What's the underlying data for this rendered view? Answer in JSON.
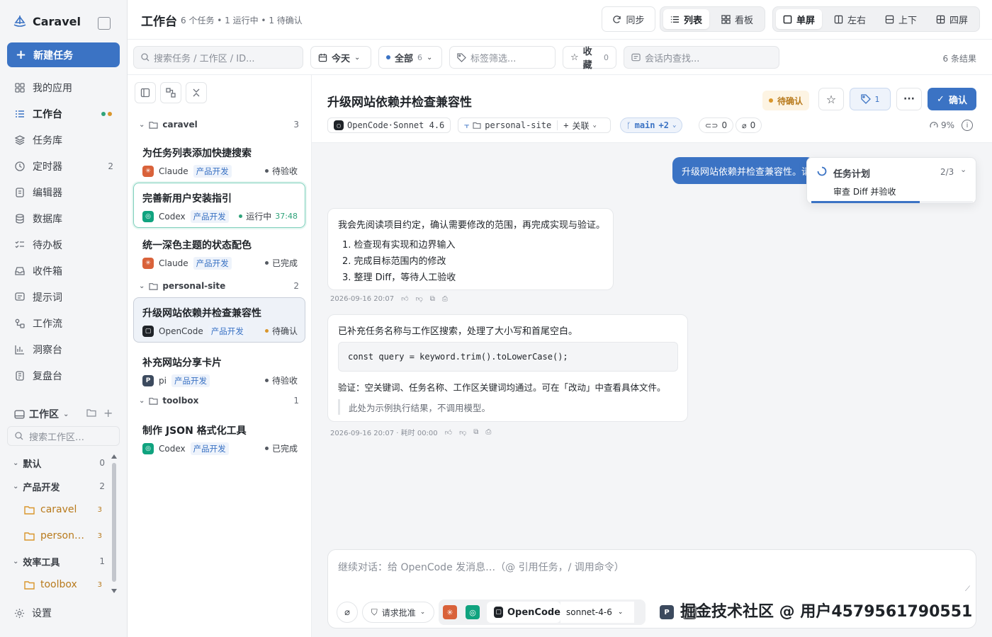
{
  "brand": {
    "name": "Caravel"
  },
  "sidebar": {
    "new_task": "新建任务",
    "items": [
      {
        "label": "我的应用",
        "icon": "grid-icon",
        "count": ""
      },
      {
        "label": "工作台",
        "icon": "list-icon",
        "count": ""
      },
      {
        "label": "任务库",
        "icon": "layers-icon",
        "count": ""
      },
      {
        "label": "定时器",
        "icon": "clock-icon",
        "count": "2"
      },
      {
        "label": "编辑器",
        "icon": "editor-icon",
        "count": ""
      },
      {
        "label": "数据库",
        "icon": "database-icon",
        "count": ""
      },
      {
        "label": "待办板",
        "icon": "checklist-icon",
        "count": ""
      },
      {
        "label": "收件箱",
        "icon": "inbox-icon",
        "count": ""
      },
      {
        "label": "提示词",
        "icon": "message-icon",
        "count": ""
      },
      {
        "label": "工作流",
        "icon": "workflow-icon",
        "count": ""
      },
      {
        "label": "洞察台",
        "icon": "chart-icon",
        "count": ""
      },
      {
        "label": "复盘台",
        "icon": "review-icon",
        "count": ""
      }
    ],
    "workspace_title": "工作区",
    "workspace_search_placeholder": "搜索工作区…",
    "tree": [
      {
        "label": "默认",
        "count": "0"
      },
      {
        "label": "产品开发",
        "count": "2"
      },
      {
        "label": "caravel",
        "count": "3",
        "leaf": true
      },
      {
        "label": "person…",
        "count": "3",
        "leaf": true
      },
      {
        "label": "效率工具",
        "count": "1"
      },
      {
        "label": "toolbox",
        "count": "3",
        "leaf": true
      }
    ],
    "settings": "设置",
    "colors": {
      "accent": "#3b73c4",
      "dot_green": "#2fa37a",
      "dot_amber": "#d9962b"
    }
  },
  "header": {
    "title": "工作台",
    "meta": "6 个任务 • 1 运行中 • 1 待确认",
    "sync": "同步",
    "view_list": "列表",
    "view_board": "看板",
    "layout_single": "单屏",
    "layout_lr": "左右",
    "layout_tb": "上下",
    "layout_four": "四屏"
  },
  "filters": {
    "search_placeholder": "搜索任务 / 工作区 / ID...",
    "date": "今天",
    "scope": "全部",
    "scope_count": "6",
    "tag_placeholder": "标签筛选...",
    "favorites": "收藏",
    "favorites_count": "0",
    "conv_search": "会话内查找...",
    "results": "6 条结果"
  },
  "task_groups": [
    {
      "name": "caravel",
      "count": "3"
    },
    {
      "name": "personal-site",
      "count": "2"
    },
    {
      "name": "toolbox",
      "count": "1"
    }
  ],
  "tasks": [
    {
      "title": "为任务列表添加快捷搜索",
      "agent": "Claude",
      "tag": "产品开发",
      "status": "待验收",
      "time": ""
    },
    {
      "title": "完善新用户安装指引",
      "agent": "Codex",
      "tag": "产品开发",
      "status": "运行中",
      "time": "37:48"
    },
    {
      "title": "统一深色主题的状态配色",
      "agent": "Claude",
      "tag": "产品开发",
      "status": "已完成",
      "time": ""
    },
    {
      "title": "升级网站依赖并检查兼容性",
      "agent": "OpenCode",
      "tag": "产品开发",
      "status": "待确认",
      "time": ""
    },
    {
      "title": "补充网站分享卡片",
      "agent": "pi",
      "tag": "产品开发",
      "status": "待验收",
      "time": ""
    },
    {
      "title": "制作 JSON 格式化工具",
      "agent": "Codex",
      "tag": "产品开发",
      "status": "已完成",
      "time": ""
    }
  ],
  "detail": {
    "title": "升级网站依赖并检查兼容性",
    "status": "待确认",
    "tag_count": "1",
    "confirm": "确认",
    "model": "OpenCode·Sonnet 4.6",
    "workspace": "personal-site",
    "link": "关联",
    "branch": "main",
    "branch_extra": "+2",
    "links_count": "0",
    "attach_count": "0",
    "context_pct": "9%",
    "user_msg": "升级网站依赖并检查兼容性。请",
    "plan": {
      "title": "任务计划",
      "progress": "2/3",
      "step": "审查 Diff 并验收",
      "fraction": 0.67
    },
    "msg1": {
      "intro": "我会先阅读项目约定，确认需要修改的范围，再完成实现与验证。",
      "steps": [
        "1. 检查现有实现和边界输入",
        "2. 完成目标范围内的修改",
        "3. 整理 Diff，等待人工验收"
      ],
      "meta": "2026-09-16 20:07"
    },
    "msg2": {
      "intro": "已补充任务名称与工作区搜索，处理了大小写和首尾空白。",
      "code": "const query = keyword.trim().toLowerCase();",
      "verify": "验证：空关键词、任务名称、工作区关键词均通过。可在「改动」中查看具体文件。",
      "note": "此处为示例执行结果，不调用模型。",
      "meta": "2026-09-16 20:07 · 耗时 00:00"
    },
    "composer": {
      "placeholder": "继续对话：给 OpenCode 发消息…（@ 引用任务，/ 调用命令）",
      "approval": "请求批准",
      "agent": "OpenCode",
      "model": "sonnet-4-6"
    }
  },
  "watermark": "掘金技术社区 @ 用户4579561790551"
}
